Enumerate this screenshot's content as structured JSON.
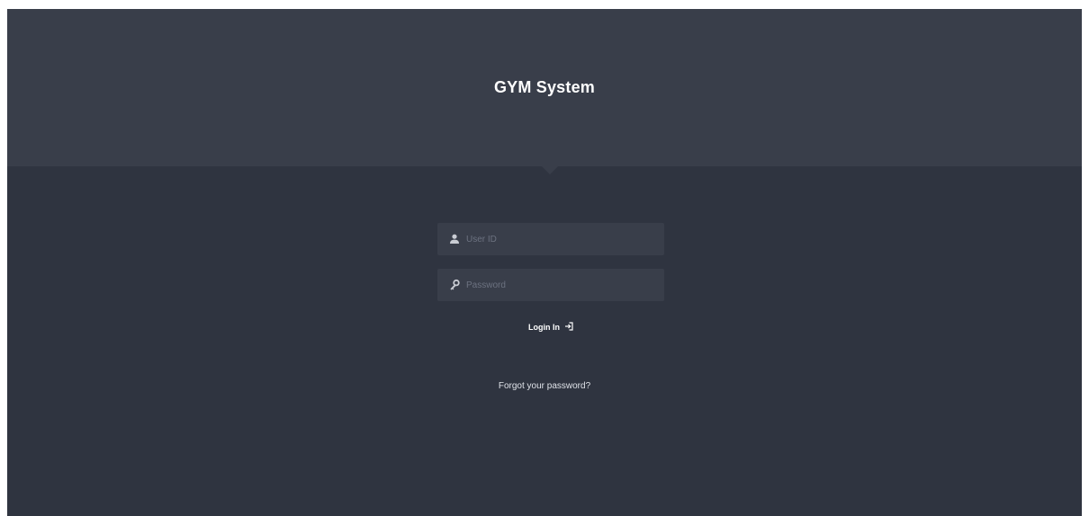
{
  "header": {
    "title": "GYM System"
  },
  "login_form": {
    "user_id": {
      "value": "",
      "placeholder": "User ID",
      "icon": "user-icon"
    },
    "password": {
      "value": "",
      "placeholder": "Password",
      "icon": "key-icon"
    },
    "login_label": "Login In",
    "login_icon": "sign-in-icon",
    "forgot_label": "Forgot your password?"
  },
  "colors": {
    "header_bg": "#393e4a",
    "body_bg": "#2f3440",
    "field_bg": "#393e4a",
    "placeholder": "#6c7280",
    "text": "#ffffff"
  }
}
